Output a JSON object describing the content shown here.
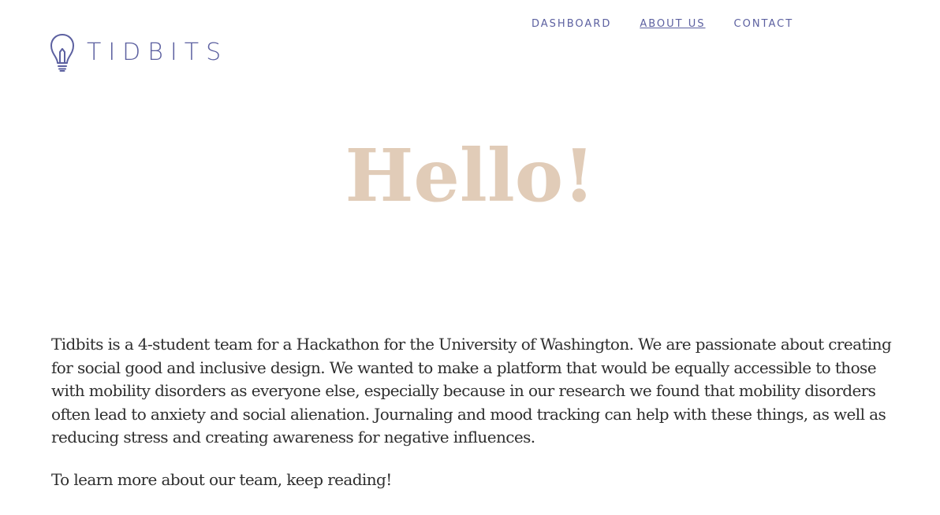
{
  "brand": {
    "name": "TIDBITS",
    "icon": "lightbulb-icon",
    "color": "#5c60a0"
  },
  "nav": {
    "items": [
      {
        "label": "DASHBOARD",
        "active": false
      },
      {
        "label": "ABOUT US",
        "active": true
      },
      {
        "label": "CONTACT",
        "active": false
      }
    ]
  },
  "hero": {
    "title": "Hello!",
    "color": "#e1ccb8"
  },
  "about": {
    "paragraph1": "Tidbits is a 4-student team for a Hackathon for the University of Washington. We are passionate about creating for social good and inclusive design. We wanted to make a platform that would be equally accessible to those with mobility disorders as everyone else, especially because in our research we found that mobility disorders often lead to anxiety and social alienation. Journaling and mood tracking can help with these things, as well as reducing stress and creating awareness for negative influences.",
    "paragraph2": "To learn more about our team, keep reading!"
  }
}
